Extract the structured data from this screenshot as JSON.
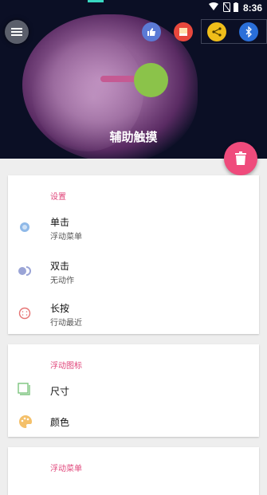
{
  "status_bar": {
    "time": "8:36"
  },
  "header": {
    "title": "辅助触摸"
  },
  "quick_icons": [
    "thumbs-up-icon",
    "screen-icon",
    "share-icon",
    "bluetooth-icon"
  ],
  "settings": {
    "section_title": "设置",
    "items": [
      {
        "title": "单击",
        "subtitle": "浮动菜单"
      },
      {
        "title": "双击",
        "subtitle": "无动作"
      },
      {
        "title": "长按",
        "subtitle": "行动最近"
      }
    ]
  },
  "floating_icon": {
    "section_title": "浮动图标",
    "items": [
      {
        "title": "尺寸"
      },
      {
        "title": "颜色"
      }
    ]
  },
  "floating_menu": {
    "section_title": "浮动菜单"
  },
  "colors": {
    "accent": "#ef4b7c",
    "section_title": "#e0457a",
    "ball": "#8bc34a"
  }
}
